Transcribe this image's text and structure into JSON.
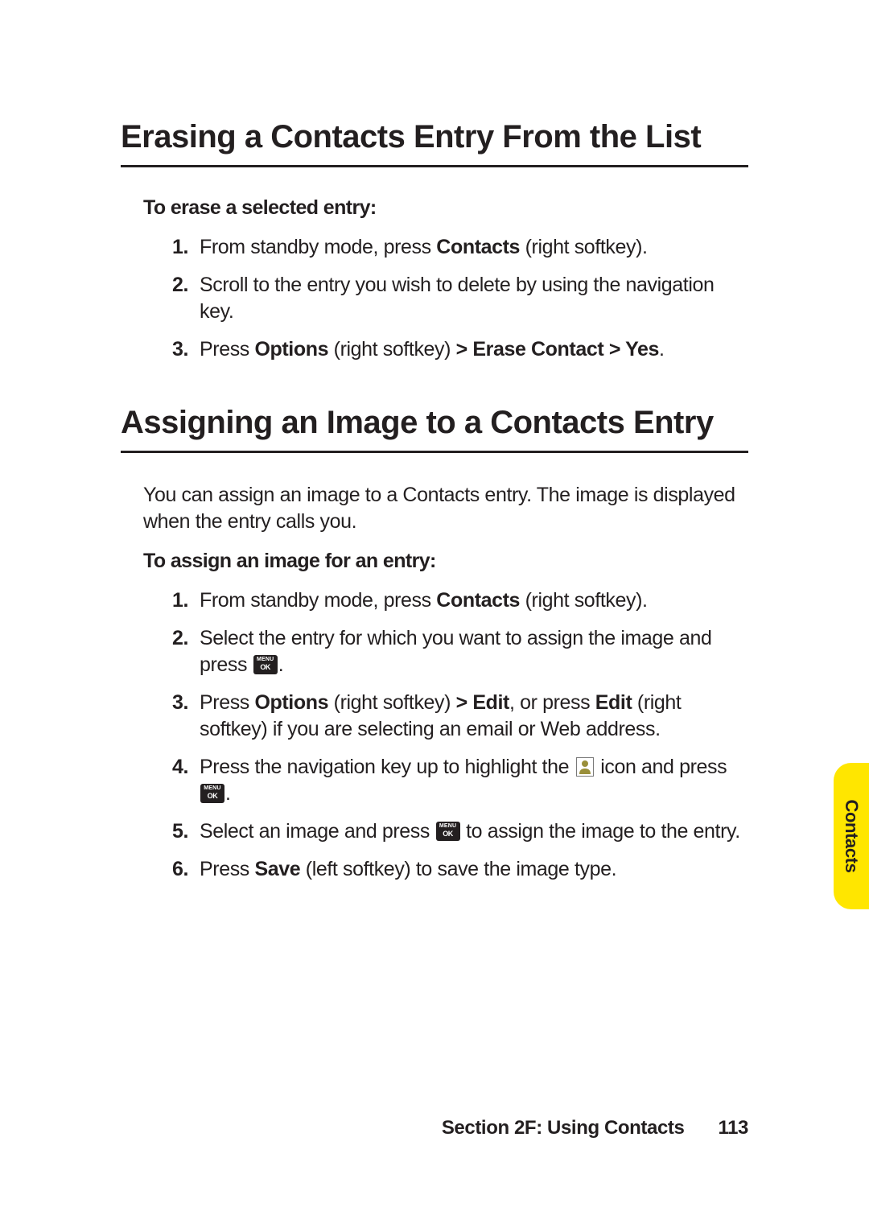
{
  "section1": {
    "heading": "Erasing a Contacts Entry From the List",
    "subhead": "To erase a selected entry:",
    "steps": {
      "s1a": "From standby mode, press ",
      "s1b": "Contacts",
      "s1c": " (right softkey).",
      "s2": "Scroll to the entry you wish to delete by using the navigation key.",
      "s3a": "Press ",
      "s3b": "Options",
      "s3c": " (right softkey) ",
      "s3d": "> Erase Contact > Yes",
      "s3e": "."
    }
  },
  "section2": {
    "heading": "Assigning an Image to a Contacts Entry",
    "intro": "You can assign an image to a Contacts entry. The image is displayed when the entry calls you.",
    "subhead": "To assign an image for an entry:",
    "steps": {
      "s1a": "From standby mode, press ",
      "s1b": "Contacts",
      "s1c": " (right softkey).",
      "s2a": "Select the entry for which you want to assign the image and press ",
      "s2b": ".",
      "s3a": "Press ",
      "s3b": "Options",
      "s3c": " (right softkey) ",
      "s3d": "> Edit",
      "s3e": ", or press ",
      "s3f": "Edit",
      "s3g": " (right softkey) if you are selecting an email or Web address.",
      "s4a": "Press the navigation key up to highlight the ",
      "s4b": " icon and press ",
      "s4c": ".",
      "s5a": "Select an image and press ",
      "s5b": " to assign the image to the entry.",
      "s6a": "Press ",
      "s6b": "Save",
      "s6c": " (left softkey) to save the image type."
    }
  },
  "tab": {
    "label": "Contacts"
  },
  "footer": {
    "section": "Section 2F: Using Contacts",
    "page": "113"
  },
  "icons": {
    "menu_ok": "menu-ok-icon",
    "contact": "contact-icon"
  },
  "numbers": {
    "n1": "1.",
    "n2": "2.",
    "n3": "3.",
    "n4": "4.",
    "n5": "5.",
    "n6": "6."
  }
}
